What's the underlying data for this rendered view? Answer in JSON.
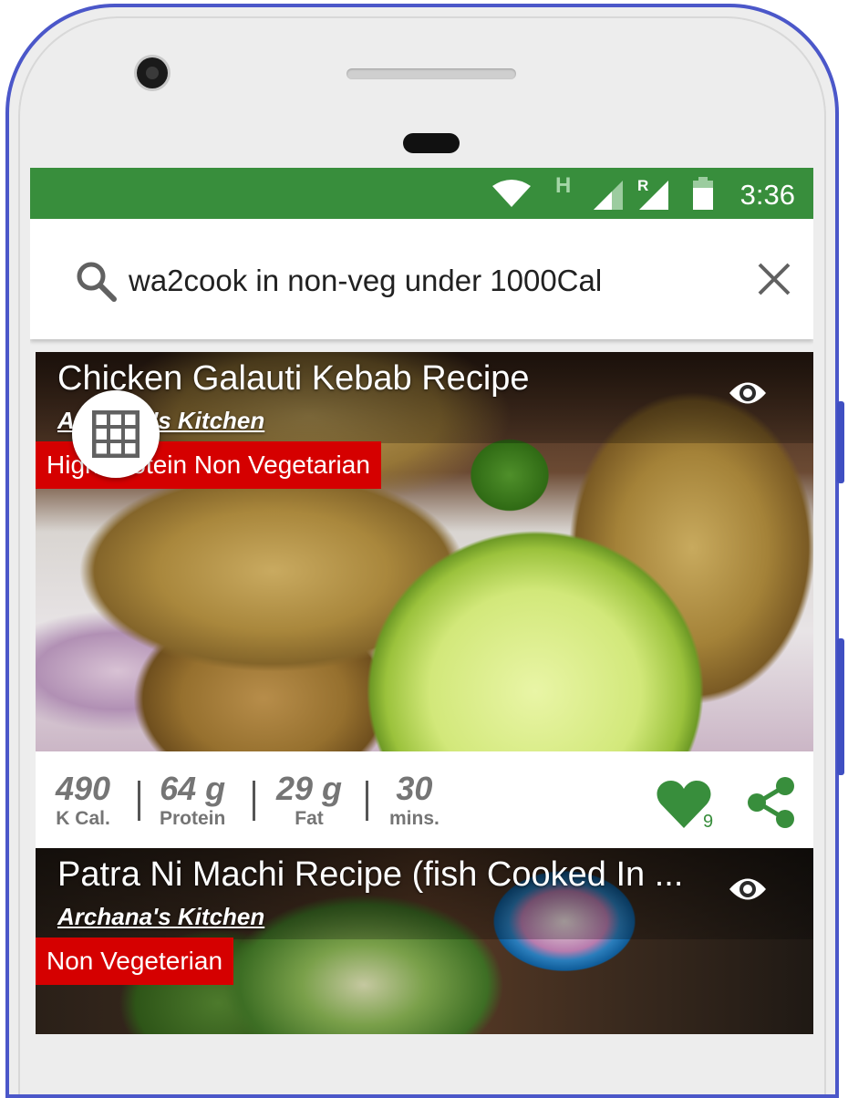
{
  "statusbar": {
    "time": "3:36",
    "network_label": "H",
    "roaming_label": "R",
    "icons": [
      "wifi-icon",
      "signal-icon",
      "roaming-signal-icon",
      "battery-icon"
    ],
    "color": "#388e3c"
  },
  "search": {
    "query": "wa2cook in non-veg under 1000Cal",
    "icons": [
      "search-icon",
      "close-icon"
    ]
  },
  "recipes": [
    {
      "title": "Chicken Galauti Kebab Recipe",
      "author": "Archana's Kitchen",
      "category": "High Protein Non Vegetarian",
      "stats": {
        "calories_value": "490",
        "calories_label": "K Cal.",
        "protein_value": "64 g",
        "protein_label": "Protein",
        "fat_value": "29 g",
        "fat_label": "Fat",
        "time_value": "30",
        "time_label": "mins."
      },
      "likes": "9"
    },
    {
      "title": "Patra Ni Machi Recipe (fish Cooked In ...",
      "author": "Archana's Kitchen",
      "category": "Non Vegeterian"
    }
  ],
  "colors": {
    "accent_green": "#388e3c",
    "tag_red": "#d50000",
    "stat_gray": "#757575"
  }
}
